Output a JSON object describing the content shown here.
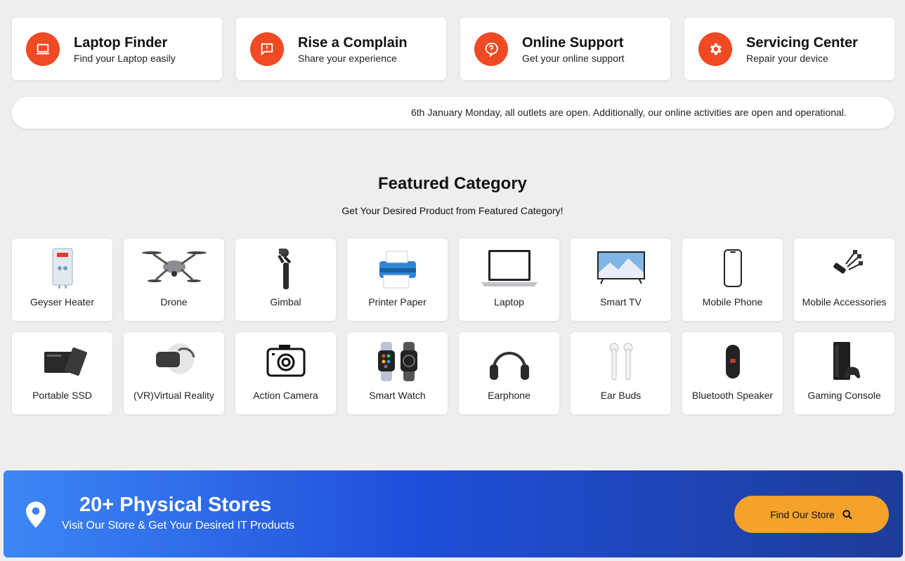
{
  "services": [
    {
      "title": "Laptop Finder",
      "subtitle": "Find your Laptop easily",
      "icon": "laptop-icon"
    },
    {
      "title": "Rise a Complain",
      "subtitle": "Share your experience",
      "icon": "message-alert-icon"
    },
    {
      "title": "Online Support",
      "subtitle": "Get your online support",
      "icon": "help-icon"
    },
    {
      "title": "Servicing Center",
      "subtitle": "Repair your device",
      "icon": "gear-icon"
    }
  ],
  "notice": {
    "text": "6th January Monday, all outlets are open. Additionally, our online activities are open and operational."
  },
  "featured": {
    "title": "Featured Category",
    "subtitle": "Get Your Desired Product from Featured Category!",
    "categories": [
      {
        "label": "Geyser Heater"
      },
      {
        "label": "Drone"
      },
      {
        "label": "Gimbal"
      },
      {
        "label": "Printer Paper"
      },
      {
        "label": "Laptop"
      },
      {
        "label": "Smart TV"
      },
      {
        "label": "Mobile Phone"
      },
      {
        "label": "Mobile Accessories"
      },
      {
        "label": "Portable SSD"
      },
      {
        "label": "(VR)Virtual Reality"
      },
      {
        "label": "Action Camera"
      },
      {
        "label": "Smart Watch"
      },
      {
        "label": "Earphone"
      },
      {
        "label": "Ear Buds"
      },
      {
        "label": "Bluetooth Speaker"
      },
      {
        "label": "Gaming Console"
      }
    ]
  },
  "banner": {
    "title": "20+ Physical Stores",
    "subtitle": "Visit Our Store & Get Your Desired IT Products",
    "button_label": "Find Our Store"
  },
  "colors": {
    "accent": "#ef4a23",
    "button": "#f4a229",
    "banner_start": "#3d86f5",
    "banner_end": "#1e3c99"
  }
}
